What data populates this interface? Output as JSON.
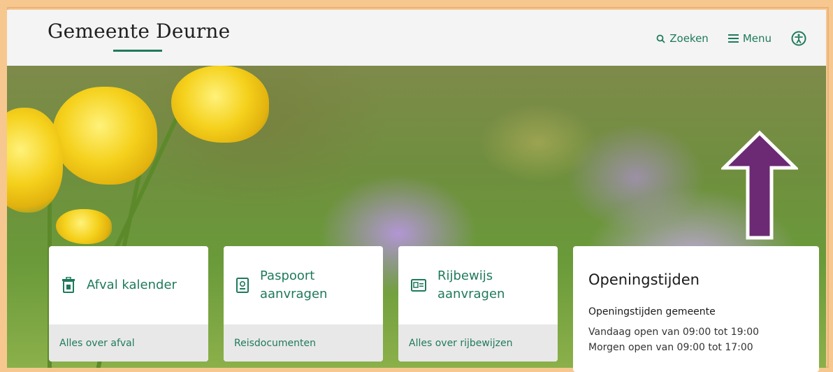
{
  "header": {
    "logo": "Gemeente Deurne",
    "search_label": "Zoeken",
    "menu_label": "Menu"
  },
  "icons": {
    "search": "search-icon",
    "menu": "hamburger-menu-icon",
    "accessibility": "accessibility-icon",
    "afval": "trash-calendar-icon",
    "paspoort": "passport-icon",
    "rijbewijs": "id-card-icon"
  },
  "cards": [
    {
      "title": "Afval kalender",
      "footer": "Alles over afval"
    },
    {
      "title": "Paspoort aanvragen",
      "footer": "Reisdocumenten"
    },
    {
      "title": "Rijbewijs aanvragen",
      "footer": "Alles over rijbewijzen"
    }
  ],
  "openings": {
    "title": "Openingstijden",
    "subtitle": "Openingstijden gemeente",
    "today": "Vandaag open van 09:00 tot 19:00",
    "tomorrow": "Morgen open van 09:00 tot 17:00"
  },
  "colors": {
    "accent": "#1f7a5c",
    "arrow": "#6b2a73",
    "frame": "#f6c88f"
  }
}
